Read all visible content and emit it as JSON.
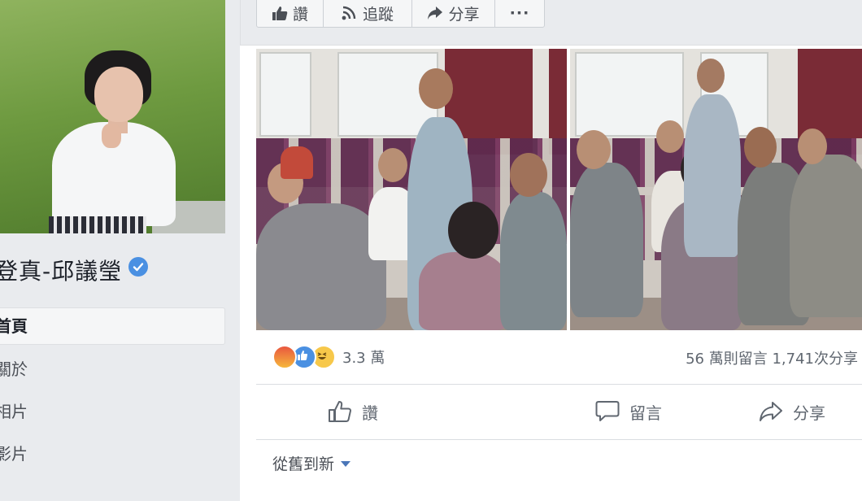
{
  "page": {
    "name": "登真-邱議瑩",
    "verified": true
  },
  "nav": {
    "items": [
      {
        "label": "首頁",
        "active": true
      },
      {
        "label": "關於",
        "active": false
      },
      {
        "label": "相片",
        "active": false
      },
      {
        "label": "影片",
        "active": false
      }
    ]
  },
  "top_bar": {
    "like_label": "讚",
    "follow_label": "追蹤",
    "share_label": "分享",
    "more_label": "···"
  },
  "post": {
    "reaction_icons": [
      "angry-icon",
      "like-icon",
      "haha-icon"
    ],
    "reaction_count": "3.3 萬",
    "comments_shares": "56 萬則留言  1,741次分享",
    "actions": {
      "like_label": "讚",
      "comment_label": "留言",
      "share_label": "分享"
    },
    "sort_label": "從舊到新"
  },
  "colors": {
    "accent": "#4a76b8",
    "verified": "#4a90e2",
    "background": "#e9ebee"
  }
}
